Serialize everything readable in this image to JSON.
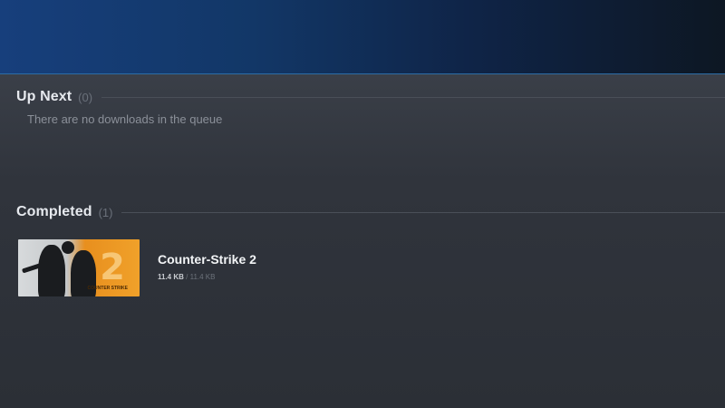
{
  "sections": {
    "up_next": {
      "title": "Up Next",
      "count": "(0)",
      "empty_text": "There are no downloads in the queue"
    },
    "completed": {
      "title": "Completed",
      "count": "(1)",
      "items": [
        {
          "title": "Counter-Strike 2",
          "downloaded": "11.4 KB",
          "separator": "/",
          "total": "11.4 KB",
          "capsule_number": "2",
          "capsule_text": "COUNTER STRIKE"
        }
      ]
    }
  },
  "colors": {
    "banner": "#123767",
    "background": "#2e323a",
    "accent": "#e88f1e"
  }
}
